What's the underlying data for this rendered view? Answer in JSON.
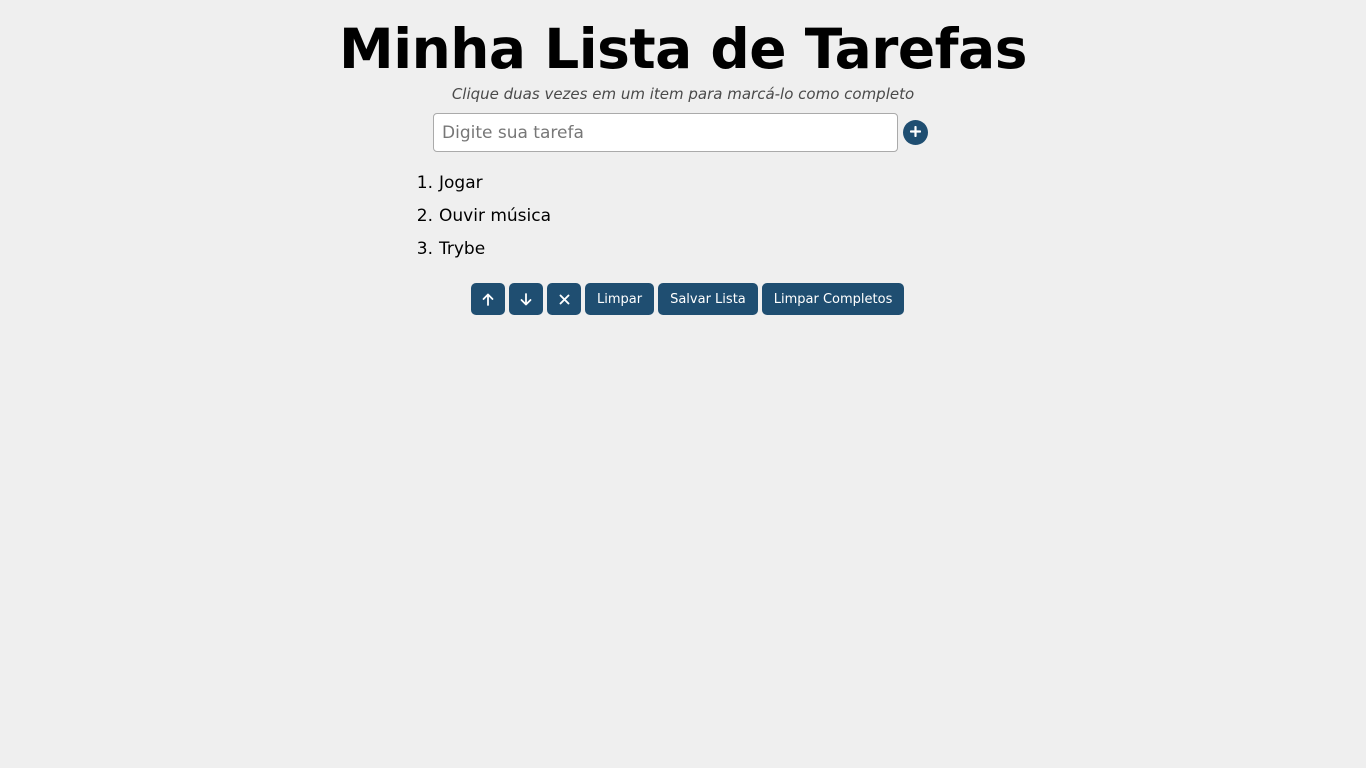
{
  "header": {
    "title": "Minha Lista de Tarefas",
    "subtitle": "Clique duas vezes em um item para marcá-lo como completo"
  },
  "input": {
    "placeholder": "Digite sua tarefa",
    "value": "",
    "add_icon": "plus-icon"
  },
  "tasks": [
    {
      "number": "1.",
      "label": "Jogar"
    },
    {
      "number": "2.",
      "label": "Ouvir música"
    },
    {
      "number": "3.",
      "label": "Trybe"
    }
  ],
  "controls": {
    "move_up_icon": "arrow-up-icon",
    "move_down_icon": "arrow-down-icon",
    "remove_icon": "close-icon",
    "clear_label": "Limpar",
    "save_label": "Salvar Lista",
    "clear_completed_label": "Limpar Completos"
  },
  "colors": {
    "background": "#efefef",
    "accent": "#1f4e71"
  }
}
